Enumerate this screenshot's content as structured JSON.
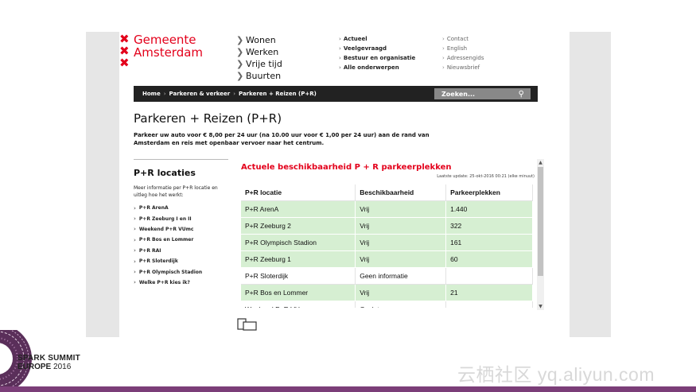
{
  "logo": {
    "crosses": [
      "✖",
      "✖",
      "✖"
    ],
    "line1": "Gemeente",
    "line2": "Amsterdam",
    "color": "#e3001b"
  },
  "nav_main": [
    "Wonen",
    "Werken",
    "Vrije tijd",
    "Buurten"
  ],
  "nav_secondary": [
    "Actueel",
    "Veelgevraagd",
    "Bestuur en organisatie",
    "Alle onderwerpen"
  ],
  "nav_tertiary": [
    "Contact",
    "English",
    "Adressengids",
    "Nieuwsbrief"
  ],
  "breadcrumb": [
    "Home",
    "Parkeren & verkeer",
    "Parkeren + Reizen (P+R)"
  ],
  "search": {
    "placeholder": "Zoeken..."
  },
  "page": {
    "title": "Parkeren + Reizen (P+R)",
    "intro": "Parkeer uw auto voor € 8,00 per 24 uur (na 10.00 uur voor € 1,00 per 24 uur) aan de rand van Amsterdam en reis met openbaar vervoer naar het centrum."
  },
  "locations": {
    "title": "P+R locaties",
    "intro": "Meer informatie per P+R locatie en uitleg hoe het werkt:",
    "items": [
      "P+R ArenA",
      "P+R Zeeburg I en II",
      "Weekend P+R VUmc",
      "P+R Bos en Lommer",
      "P+R RAI",
      "P+R Sloterdijk",
      "P+R Olympisch Stadion",
      "Welke P+R kies ik?"
    ]
  },
  "widget": {
    "title": "Actuele beschikbaarheid P + R parkeerplekken",
    "last_update": "Laatste update: 25-okt-2016 00:21 (elke minuut)",
    "headers": [
      "P+R locatie",
      "Beschikbaarheid",
      "Parkeerplekken"
    ],
    "rows": [
      [
        "P+R ArenA",
        "Vrij",
        "1.440"
      ],
      [
        "P+R Zeeburg 2",
        "Vrij",
        "322"
      ],
      [
        "P+R Olympisch Stadion",
        "Vrij",
        "161"
      ],
      [
        "P+R Zeeburg 1",
        "Vrij",
        "60"
      ],
      [
        "P+R Sloterdijk",
        "Geen informatie",
        ""
      ],
      [
        "P+R Bos en Lommer",
        "Vrij",
        "21"
      ],
      [
        "Weekend P+R VUmc",
        "Gesloten",
        ""
      ]
    ],
    "available_color": "#d6efd2",
    "title_color": "#e3001b"
  },
  "branding": {
    "line1": "SPARK SUMMIT",
    "line2": "EUROPE",
    "year": "2016",
    "watermark": "云栖社区 yq.aliyun.com"
  }
}
